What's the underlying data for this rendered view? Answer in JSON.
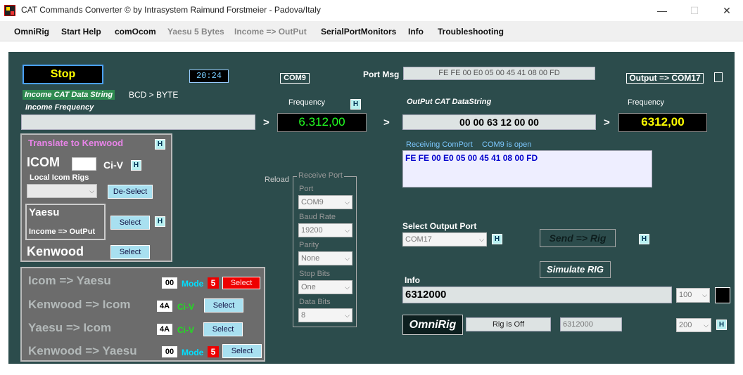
{
  "window": {
    "title": "CAT Commands Converter © by Intrasystem Raimund Forstmeier - Padova/Italy",
    "minimize": "—",
    "maximize": "☐",
    "close": "✕"
  },
  "menu": [
    "OmniRig",
    "Start Help",
    "comOcom",
    "Yaesu 5 Bytes",
    "Income => OutPut",
    "SerialPortMonitors",
    "Info",
    "Troubleshooting"
  ],
  "top": {
    "stop": "Stop",
    "clock": "20:24",
    "com_in": "COM9",
    "port_msg_label": "Port Msg",
    "port_msg": "FE FE 00 E0 05 00 45 41 08 00 FD",
    "output_label": "Output => COM17"
  },
  "income": {
    "data_string": "Income CAT Data String",
    "bcd": "BCD > BYTE",
    "freq_label": "Income Frequency",
    "freq_caption": "Frequency",
    "freq_value": "6.312,00",
    "h": "H",
    "arrow": ">"
  },
  "output": {
    "data_string_label": "OutPut CAT DataString",
    "data_string": "00 00 63 12 00 00",
    "freq_caption": "Frequency",
    "freq_value": "6312,00",
    "receiving": "Receiving ComPort",
    "com_open": "COM9 is open",
    "received": "FE FE 00 E0 05 00 45 41 08 00 FD"
  },
  "translate": {
    "title": "Translate to Kenwood",
    "icom": "ICOM",
    "civ": "Ci-V",
    "local_rigs": "Local Icom Rigs",
    "deselect": "De-Select",
    "yaesu": "Yaesu",
    "income_out": "Income => OutPut",
    "select": "Select",
    "kenwood": "Kenwood"
  },
  "conv": {
    "rows": [
      {
        "label": "Icom => Yaesu",
        "code": "00",
        "mode": "Mode",
        "num": "5",
        "button": "Select"
      },
      {
        "label": "Kenwood => Icom",
        "code": "4A",
        "mode": "Ci-V",
        "button": "Select"
      },
      {
        "label": "Yaesu => Icom",
        "code": "4A",
        "mode": "Ci-V",
        "button": "Select"
      },
      {
        "label": "Kenwood => Yaesu",
        "code": "00",
        "mode": "Mode",
        "num": "5",
        "button": "Select"
      }
    ]
  },
  "receive_port": {
    "reload": "Reload",
    "group": "Receive Port",
    "port_label": "Port",
    "port": "COM9",
    "baud_label": "Baud Rate",
    "baud": "19200",
    "parity_label": "Parity",
    "parity": "None",
    "stop_label": "Stop Bits",
    "stop": "One",
    "data_label": "Data Bits",
    "data": "8"
  },
  "output_port": {
    "label": "Select Output Port",
    "port": "COM17",
    "send": "Send => Rig",
    "simulate": "Simulate RIG",
    "info_label": "Info",
    "info": "6312000",
    "combo100": "100",
    "omnirig": "OmniRig",
    "rig_status": "Rig is Off",
    "rig_freq": "6312000",
    "combo200": "200"
  },
  "colors": {
    "bg": "#2c4c4c",
    "green_lcd": "#22ff22",
    "yellow_lcd": "#ffff00",
    "cyan": "#00e0ff",
    "lime": "#22dd22"
  }
}
